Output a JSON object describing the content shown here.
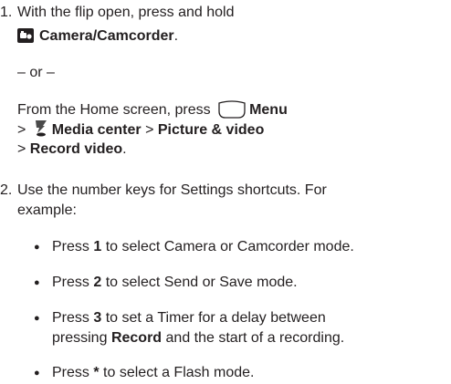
{
  "step1": {
    "number": "1.",
    "line1": "With the flip open, press and hold",
    "camera_label": "Camera/Camcorder",
    "period": ".",
    "or_text": "– or –",
    "home_prefix": "From the Home screen, press",
    "menu_label": "Menu",
    "gt1": ">",
    "media_center": "Media center",
    "gt2": ">",
    "picture_video": "Picture & video",
    "gt3": ">",
    "record_video": "Record video",
    "period2": "."
  },
  "step2": {
    "number": "2.",
    "line1": "Use the number keys for Settings shortcuts. For",
    "line2": "example:",
    "bullets": [
      {
        "press": "Press",
        "key": "1",
        "rest": "to select Camera or Camcorder mode."
      },
      {
        "press": "Press",
        "key": "2",
        "rest": "to select Send or Save mode."
      },
      {
        "press": "Press",
        "key": "3",
        "rest1": "to set a Timer for a delay between",
        "line2_bold": "Record",
        "line2_rest": "and the start of a recording.",
        "line2_prefix": "pressing"
      },
      {
        "press": "Press",
        "key": "*",
        "rest": "to select a Flash mode."
      }
    ]
  },
  "icons": {
    "camera": "camera-icon",
    "menu_key": "menu-key-icon",
    "media_center": "media-center-icon"
  }
}
